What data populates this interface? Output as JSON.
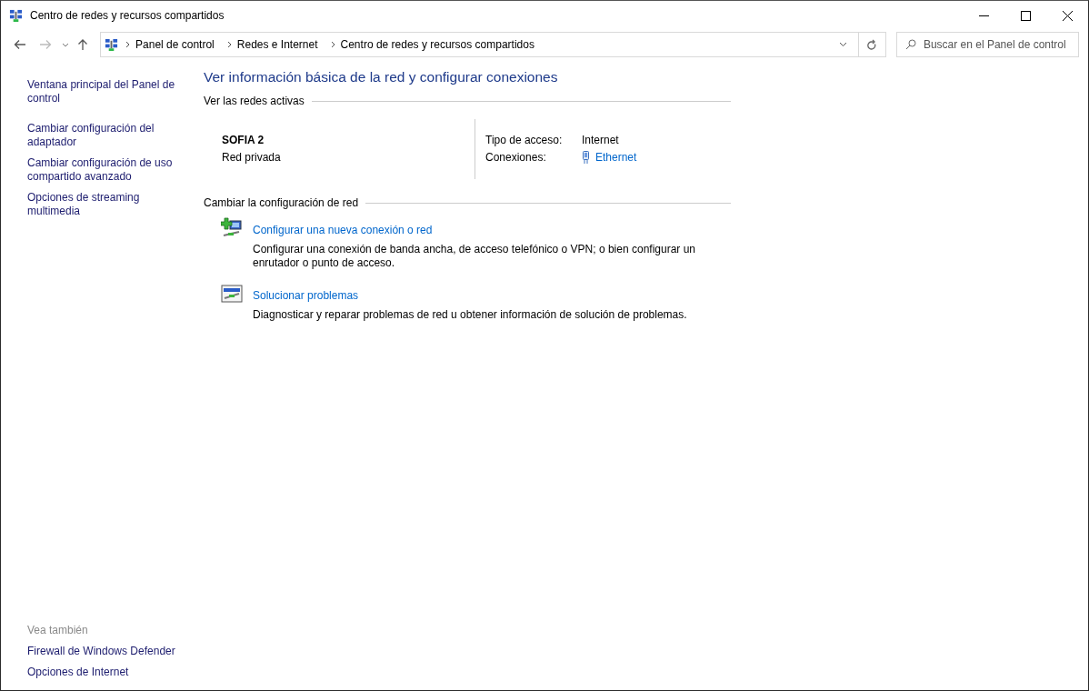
{
  "window": {
    "title": "Centro de redes y recursos compartidos"
  },
  "navigation": {
    "breadcrumbs": [
      "Panel de control",
      "Redes e Internet",
      "Centro de redes y recursos compartidos"
    ],
    "search": {
      "placeholder": "Buscar en el Panel de control"
    }
  },
  "sidebar": {
    "items": [
      "Ventana principal del Panel de control",
      "Cambiar configuración del adaptador",
      "Cambiar configuración de uso compartido avanzado",
      "Opciones de streaming multimedia"
    ],
    "see_also": {
      "heading": "Vea también",
      "items": [
        "Firewall de Windows Defender",
        "Opciones de Internet"
      ]
    }
  },
  "main": {
    "heading": "Ver información básica de la red y configurar conexiones",
    "active_networks": {
      "heading": "Ver las redes activas",
      "name": "SOFIA 2",
      "type": "Red privada",
      "details": [
        {
          "label": "Tipo de acceso:",
          "value": "Internet",
          "kind": "text"
        },
        {
          "label": "Conexiones:",
          "value": "Ethernet",
          "kind": "link"
        }
      ]
    },
    "change_settings": {
      "heading": "Cambiar la configuración de red",
      "tasks": [
        {
          "kind": "new-connection",
          "title": "Configurar una nueva conexión o red",
          "description": "Configurar una conexión de banda ancha, de acceso telefónico o VPN; o bien configurar un enrutador o punto de acceso."
        },
        {
          "kind": "troubleshoot",
          "title": "Solucionar problemas",
          "description": "Diagnosticar y reparar problemas de red u obtener información de solución de problemas."
        }
      ]
    }
  }
}
